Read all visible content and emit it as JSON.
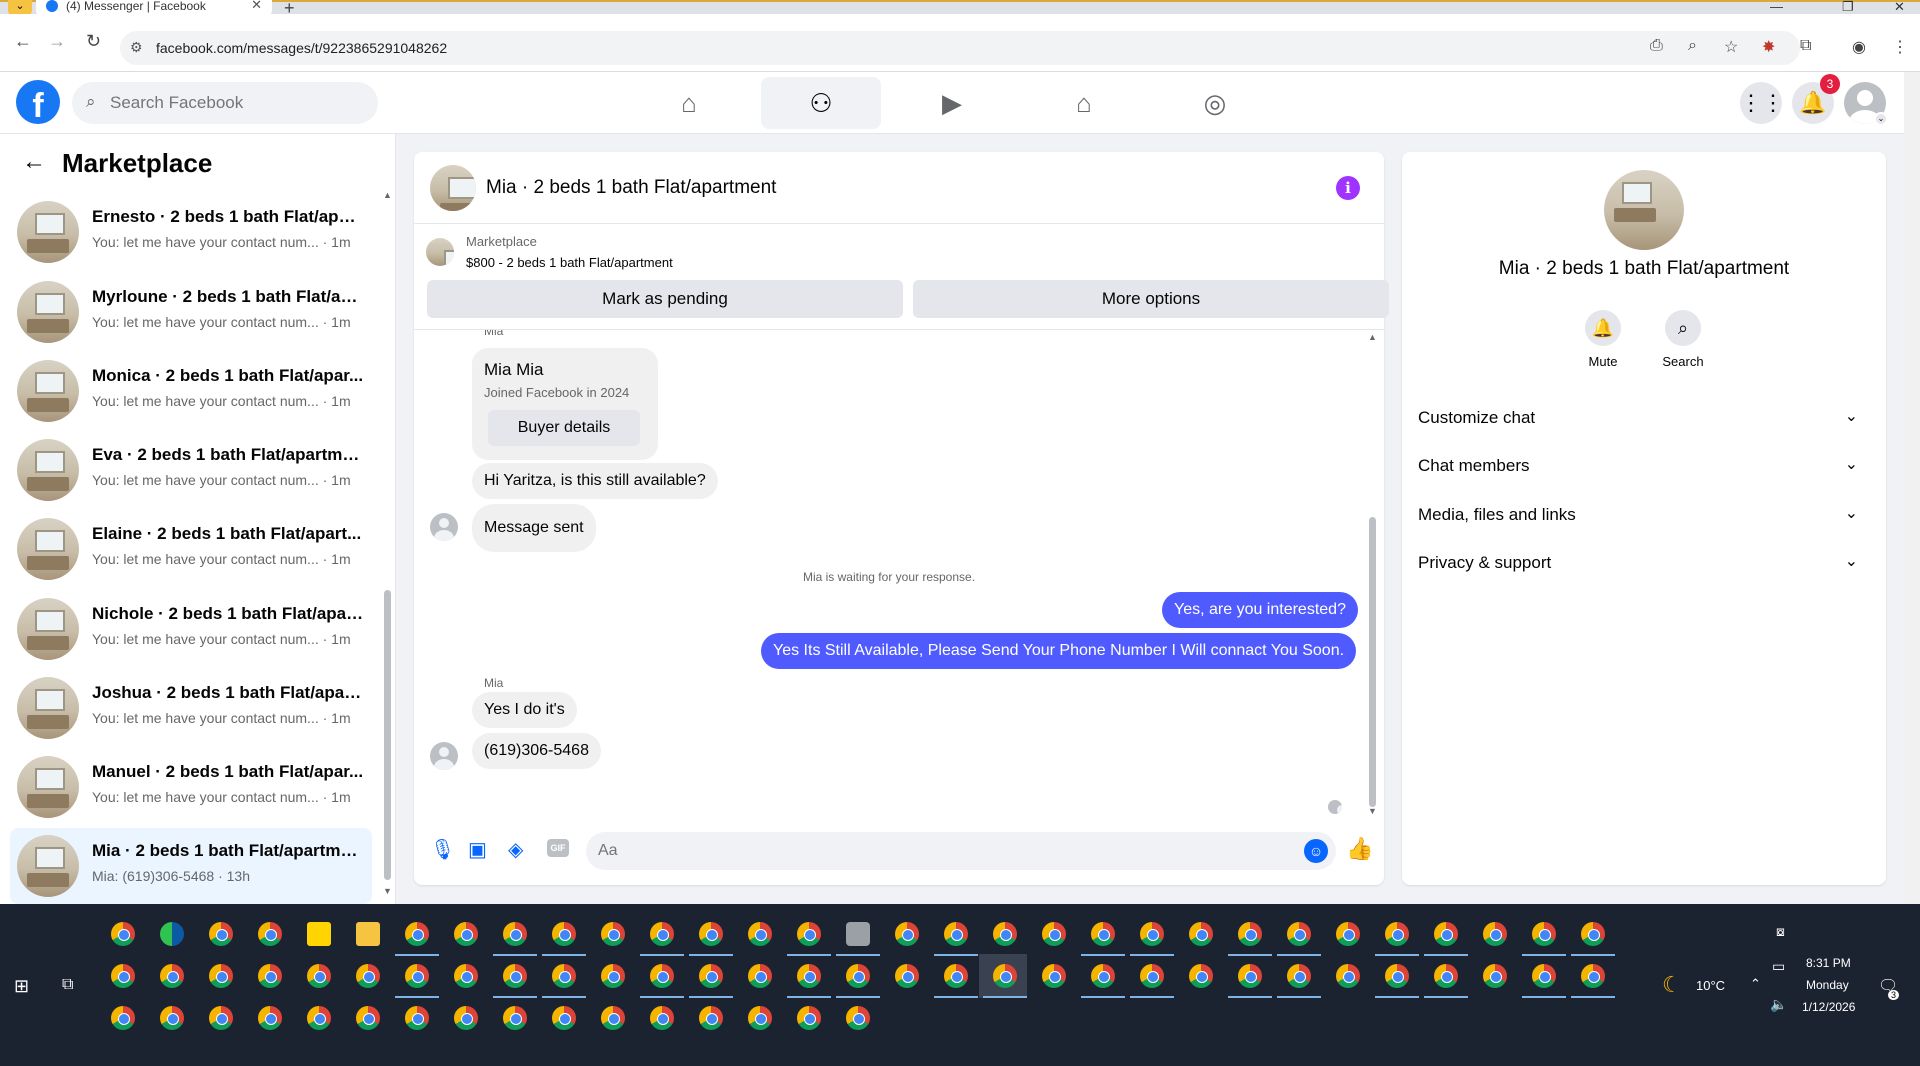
{
  "browser": {
    "tab_title": "(4) Messenger | Facebook",
    "tab_close": "✕",
    "new_tab": "+",
    "url": "facebook.com/messages/t/9223865291048262"
  },
  "fb": {
    "search_placeholder": "Search Facebook",
    "notifications_count": "3",
    "brand_color": "#1877f2"
  },
  "sidebar": {
    "title": "Marketplace",
    "conversations": [
      {
        "name": "Ernesto · 2 beds 1 bath Flat/apar...",
        "preview": "You: let me have your contact num... · 1m"
      },
      {
        "name": "Myrloune · 2 beds 1 bath Flat/ap...",
        "preview": "You: let me have your contact num... · 1m"
      },
      {
        "name": "Monica · 2 beds 1 bath Flat/apar...",
        "preview": "You: let me have your contact num... · 1m"
      },
      {
        "name": "Eva · 2 beds 1 bath Flat/apartment",
        "preview": "You: let me have your contact num... · 1m"
      },
      {
        "name": "Elaine · 2 beds 1 bath Flat/apart...",
        "preview": "You: let me have your contact num... · 1m"
      },
      {
        "name": "Nichole · 2 beds 1 bath Flat/apar...",
        "preview": "You: let me have your contact num... · 1m"
      },
      {
        "name": "Joshua · 2 beds 1 bath Flat/apart...",
        "preview": "You: let me have your contact num... · 1m"
      },
      {
        "name": "Manuel · 2 beds 1 bath Flat/apar...",
        "preview": "You: let me have your contact num... · 1m"
      },
      {
        "name": "Mia · 2 beds 1 bath Flat/apartment",
        "preview": "Mia: (619)306-5468 · 13h"
      }
    ]
  },
  "chat": {
    "title": "Mia · 2 beds 1 bath Flat/apartment",
    "info_glyph": "i",
    "marketplace_label": "Marketplace",
    "listing": "$800 - 2 beds 1 bath Flat/apartment",
    "mark_pending": "Mark as pending",
    "more_options": "More options",
    "top_sender": "Mia",
    "profile_name": "Mia Mia",
    "profile_joined": "Joined Facebook in 2024",
    "buyer_details": "Buyer details",
    "msg_available": "Hi Yaritza, is this still available?",
    "msg_sent": "Message sent",
    "waiting": "Mia is waiting for your response.",
    "out1": "Yes, are you interested?",
    "out2": "Yes Its Still Available, Please Send Your Phone Number I Will connact You Soon.",
    "sender2": "Mia",
    "in1": "Yes I do it's",
    "in2": "(619)306-5468",
    "composer_placeholder": "Aa",
    "outgoing_color": "#4f5bff"
  },
  "right": {
    "name": "Mia · 2 beds 1 bath Flat/apartment",
    "mute": "Mute",
    "search": "Search",
    "sections": [
      "Customize chat",
      "Chat members",
      "Media, files and links",
      "Privacy & support"
    ]
  },
  "taskbar": {
    "weather": "10°C",
    "time": "8:31 PM",
    "day": "Monday",
    "date": "1/12/2026",
    "notif_count": "3"
  }
}
